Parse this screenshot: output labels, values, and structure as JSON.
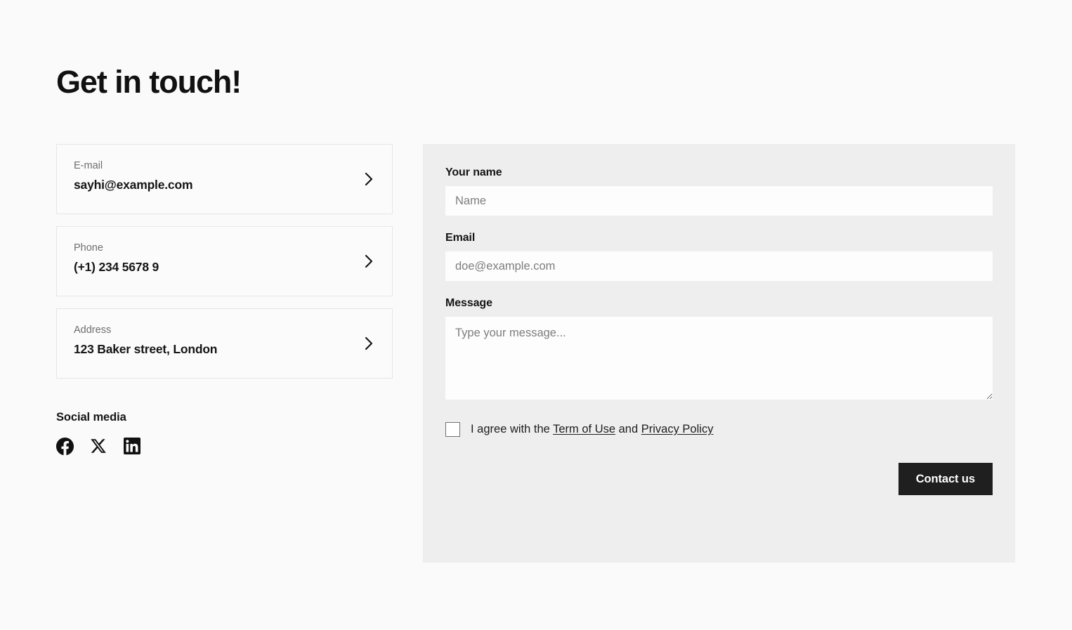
{
  "page": {
    "title": "Get in touch!",
    "background_color": "#fafafa"
  },
  "contact_cards": [
    {
      "label": "E-mail",
      "value": "sayhi@example.com",
      "icon": "chevron-right-icon"
    },
    {
      "label": "Phone",
      "value": "(+1) 234 5678 9",
      "icon": "chevron-right-icon"
    },
    {
      "label": "Address",
      "value": "123 Baker street, London",
      "icon": "chevron-right-icon"
    }
  ],
  "social": {
    "heading": "Social media",
    "items": [
      {
        "icon": "facebook-icon",
        "name": "Facebook"
      },
      {
        "icon": "x-twitter-icon",
        "name": "X"
      },
      {
        "icon": "linkedin-icon",
        "name": "LinkedIn"
      }
    ]
  },
  "form": {
    "panel_color": "#eeeeee",
    "name_label": "Your name",
    "name_placeholder": "Name",
    "name_value": "",
    "email_label": "Email",
    "email_placeholder": "doe@example.com",
    "email_value": "",
    "message_label": "Message",
    "message_placeholder": "Type your message...",
    "message_value": "",
    "agree_prefix": "I agree with the ",
    "agree_terms_link": "Term of Use",
    "agree_middle": " and ",
    "agree_privacy_link": "Privacy Policy",
    "agree_checked": false,
    "submit_label": "Contact us",
    "submit_color": "#1f1f1f"
  }
}
